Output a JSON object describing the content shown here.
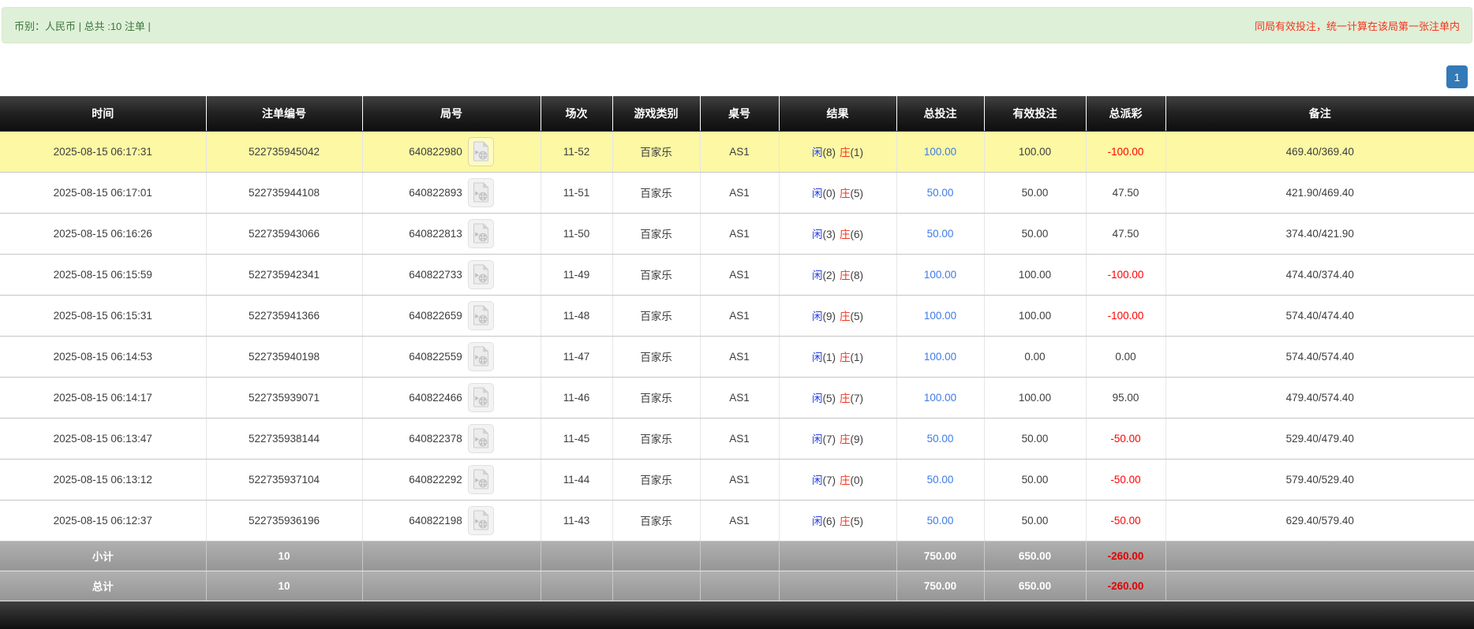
{
  "info_bar": {
    "left_text": "币别：人民币 | 总共 :10 注单 |",
    "right_text": "同局有效投注，统一计算在该局第一张注单内"
  },
  "pagination": {
    "current_page": "1"
  },
  "icons": {
    "round_video": "video-replay-icon"
  },
  "table": {
    "columns": [
      "时间",
      "注单编号",
      "局号",
      "场次",
      "游戏类别",
      "桌号",
      "结果",
      "总投注",
      "有效投注",
      "总派彩",
      "备注"
    ],
    "rows": [
      {
        "time": "2025-08-15 06:17:31",
        "bet_id": "522735945042",
        "round_no": "640822980",
        "session": "11-52",
        "game_type": "百家乐",
        "table_no": "AS1",
        "result": {
          "player_label": "闲",
          "player_score": "(8)",
          "banker_label": "庄",
          "banker_score": "(1)"
        },
        "total_bet": "100.00",
        "valid_bet": "100.00",
        "payout": "-100.00",
        "remark": "469.40/369.40",
        "highlighted": true
      },
      {
        "time": "2025-08-15 06:17:01",
        "bet_id": "522735944108",
        "round_no": "640822893",
        "session": "11-51",
        "game_type": "百家乐",
        "table_no": "AS1",
        "result": {
          "player_label": "闲",
          "player_score": "(0)",
          "banker_label": "庄",
          "banker_score": "(5)"
        },
        "total_bet": "50.00",
        "valid_bet": "50.00",
        "payout": "47.50",
        "remark": "421.90/469.40",
        "highlighted": false
      },
      {
        "time": "2025-08-15 06:16:26",
        "bet_id": "522735943066",
        "round_no": "640822813",
        "session": "11-50",
        "game_type": "百家乐",
        "table_no": "AS1",
        "result": {
          "player_label": "闲",
          "player_score": "(3)",
          "banker_label": "庄",
          "banker_score": "(6)"
        },
        "total_bet": "50.00",
        "valid_bet": "50.00",
        "payout": "47.50",
        "remark": "374.40/421.90",
        "highlighted": false
      },
      {
        "time": "2025-08-15 06:15:59",
        "bet_id": "522735942341",
        "round_no": "640822733",
        "session": "11-49",
        "game_type": "百家乐",
        "table_no": "AS1",
        "result": {
          "player_label": "闲",
          "player_score": "(2)",
          "banker_label": "庄",
          "banker_score": "(8)"
        },
        "total_bet": "100.00",
        "valid_bet": "100.00",
        "payout": "-100.00",
        "remark": "474.40/374.40",
        "highlighted": false
      },
      {
        "time": "2025-08-15 06:15:31",
        "bet_id": "522735941366",
        "round_no": "640822659",
        "session": "11-48",
        "game_type": "百家乐",
        "table_no": "AS1",
        "result": {
          "player_label": "闲",
          "player_score": "(9)",
          "banker_label": "庄",
          "banker_score": "(5)"
        },
        "total_bet": "100.00",
        "valid_bet": "100.00",
        "payout": "-100.00",
        "remark": "574.40/474.40",
        "highlighted": false
      },
      {
        "time": "2025-08-15 06:14:53",
        "bet_id": "522735940198",
        "round_no": "640822559",
        "session": "11-47",
        "game_type": "百家乐",
        "table_no": "AS1",
        "result": {
          "player_label": "闲",
          "player_score": "(1)",
          "banker_label": "庄",
          "banker_score": "(1)"
        },
        "total_bet": "100.00",
        "valid_bet": "0.00",
        "payout": "0.00",
        "remark": "574.40/574.40",
        "highlighted": false
      },
      {
        "time": "2025-08-15 06:14:17",
        "bet_id": "522735939071",
        "round_no": "640822466",
        "session": "11-46",
        "game_type": "百家乐",
        "table_no": "AS1",
        "result": {
          "player_label": "闲",
          "player_score": "(5)",
          "banker_label": "庄",
          "banker_score": "(7)"
        },
        "total_bet": "100.00",
        "valid_bet": "100.00",
        "payout": "95.00",
        "remark": "479.40/574.40",
        "highlighted": false
      },
      {
        "time": "2025-08-15 06:13:47",
        "bet_id": "522735938144",
        "round_no": "640822378",
        "session": "11-45",
        "game_type": "百家乐",
        "table_no": "AS1",
        "result": {
          "player_label": "闲",
          "player_score": "(7)",
          "banker_label": "庄",
          "banker_score": "(9)"
        },
        "total_bet": "50.00",
        "valid_bet": "50.00",
        "payout": "-50.00",
        "remark": "529.40/479.40",
        "highlighted": false
      },
      {
        "time": "2025-08-15 06:13:12",
        "bet_id": "522735937104",
        "round_no": "640822292",
        "session": "11-44",
        "game_type": "百家乐",
        "table_no": "AS1",
        "result": {
          "player_label": "闲",
          "player_score": "(7)",
          "banker_label": "庄",
          "banker_score": "(0)"
        },
        "total_bet": "50.00",
        "valid_bet": "50.00",
        "payout": "-50.00",
        "remark": "579.40/529.40",
        "highlighted": false
      },
      {
        "time": "2025-08-15 06:12:37",
        "bet_id": "522735936196",
        "round_no": "640822198",
        "session": "11-43",
        "game_type": "百家乐",
        "table_no": "AS1",
        "result": {
          "player_label": "闲",
          "player_score": "(6)",
          "banker_label": "庄",
          "banker_score": "(5)"
        },
        "total_bet": "50.00",
        "valid_bet": "50.00",
        "payout": "-50.00",
        "remark": "629.40/579.40",
        "highlighted": false
      }
    ],
    "subtotal": {
      "label": "小计",
      "count": "10",
      "total_bet": "750.00",
      "valid_bet": "650.00",
      "payout": "-260.00"
    },
    "total": {
      "label": "总计",
      "count": "10",
      "total_bet": "750.00",
      "valid_bet": "650.00",
      "payout": "-260.00"
    }
  },
  "colors": {
    "highlight_row": "#fcf8a4",
    "player_blue": "#2b43e0",
    "banker_red": "#f2321c",
    "bet_link_blue": "#3e7be8",
    "negative_red": "#ff0000",
    "info_bar_bg": "#dff0d8",
    "info_text_green": "#3c763d",
    "info_text_red": "#f5341c",
    "pagination_active_blue": "#337ab7",
    "header_black": "#1a1a1a",
    "footer_gray": "#a2a2a2"
  }
}
